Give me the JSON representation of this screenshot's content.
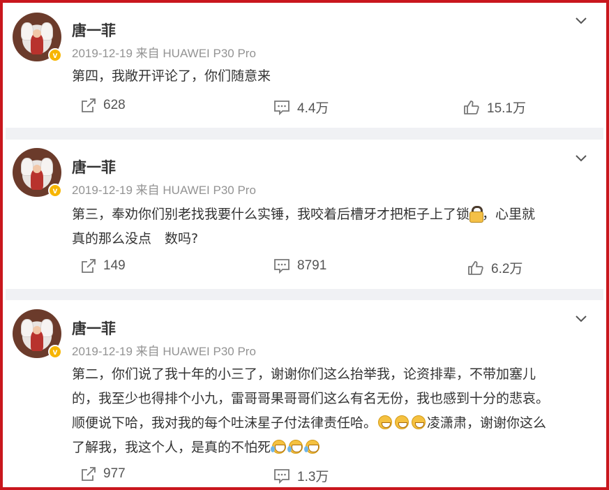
{
  "posts": [
    {
      "author": "唐一菲",
      "meta": "2019-12-19 来自 HUAWEI P30 Pro",
      "text_lines": [
        "第四，我敞开评论了，你们随意来"
      ],
      "reposts": "628",
      "comments": "4.4万",
      "likes": "15.1万"
    },
    {
      "author": "唐一菲",
      "meta": "2019-12-19 来自 HUAWEI P30 Pro",
      "text_lines": [
        "第三，奉劝你们别老找我要什么实锤，我咬着后槽牙才把柜子上了锁",
        "，心里就",
        "真的那么没点　数吗?"
      ],
      "reposts": "149",
      "comments": "8791",
      "likes": "6.2万"
    },
    {
      "author": "唐一菲",
      "meta": "2019-12-19 来自 HUAWEI P30 Pro",
      "text_lines": [
        "第二，你们说了我十年的小三了，谢谢你们这么抬举我，论资排辈，不带加塞儿",
        "的，我至少也得排个小九，雷哥哥果哥哥们这么有名无份，我也感到十分的悲哀。",
        "顺便说下哈，我对我的每个吐沫星子付法律责任哈。",
        "凌潇肃，谢谢你这么",
        "了解我，我这个人，是真的不怕死"
      ],
      "reposts": "977",
      "comments": "1.3万",
      "likes": ""
    }
  ],
  "icons": {
    "verified": "verified-badge-icon",
    "more": "chevron-down-icon",
    "repost": "share-icon",
    "comment": "comment-icon",
    "like": "thumbs-up-icon"
  },
  "colors": {
    "frame": "#c9171d",
    "badge": "#f7b500",
    "meta": "#939393",
    "separator": "#f0f1f4"
  }
}
